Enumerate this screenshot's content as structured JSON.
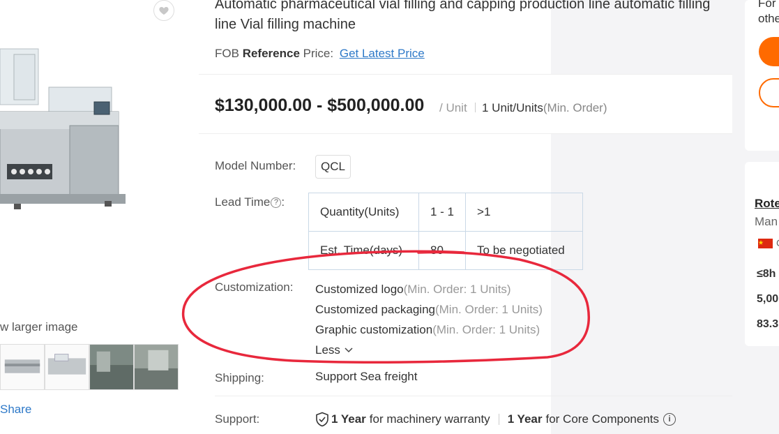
{
  "product": {
    "title": "Automatic pharmaceutical vial filling and capping production line automatic filling line Vial filling machine",
    "fob_prefix": "FOB",
    "fob_bold": "Reference",
    "fob_suffix": "Price:",
    "fob_link": "Get Latest Price",
    "price_range": "$130,000.00 - $500,000.00",
    "price_unit": "/ Unit",
    "moq_value": "1 Unit/Units",
    "moq_note": "(Min. Order)"
  },
  "gallery": {
    "view_larger": "w larger image",
    "share": "Share"
  },
  "attributes": {
    "model_label": "Model Number:",
    "model_value": "QCL",
    "lead_label": "Lead Time",
    "lead_help": "?",
    "lead_table": {
      "header": [
        "Quantity(Units)",
        "1 - 1",
        ">1"
      ],
      "row": [
        "Est. Time(days)",
        "80",
        "To be negotiated"
      ]
    },
    "customization_label": "Customization:",
    "customization_items": [
      {
        "name": "Customized logo",
        "note": "(Min. Order: 1 Units)"
      },
      {
        "name": "Customized packaging",
        "note": "(Min. Order: 1 Units)"
      },
      {
        "name": "Graphic customization",
        "note": "(Min. Order: 1 Units)"
      }
    ],
    "less_label": "Less",
    "shipping_label": "Shipping:",
    "shipping_value": "Support Sea freight",
    "support_label": "Support:",
    "support_1_bold": "1 Year",
    "support_1_text": "for machinery warranty",
    "support_2_bold": "1 Year",
    "support_2_text": "for Core Components",
    "info_icon": "i"
  },
  "right_panel": {
    "text_line1": "For",
    "text_line2": "othe",
    "company": "Rote",
    "company_type": "Man",
    "flag_letter": "C",
    "stat1": "≤8h",
    "stat2": "5,00",
    "stat3": "83.3"
  },
  "colors": {
    "accent": "#ff6a00",
    "link": "#2e79c8",
    "annotation": "#e8283c"
  },
  "icons": [
    "heart-icon",
    "help-circle-icon",
    "chevron-down-icon",
    "shield-check-icon",
    "info-icon",
    "china-flag-icon"
  ]
}
